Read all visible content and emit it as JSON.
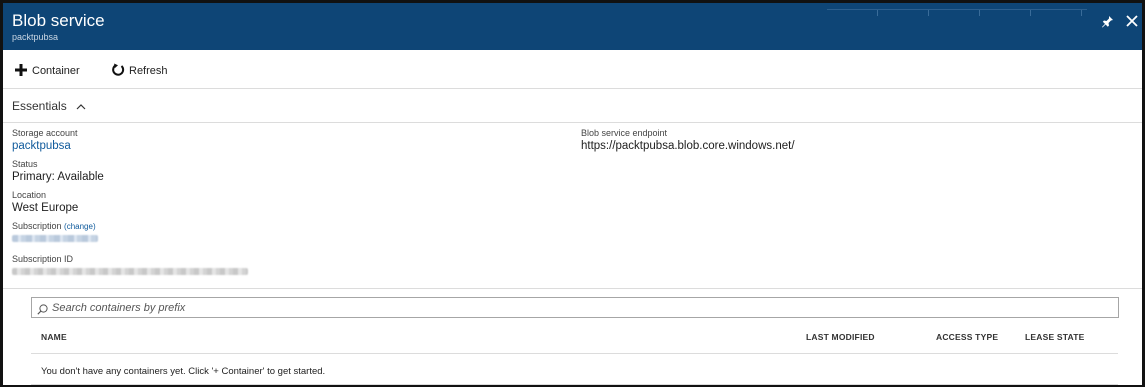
{
  "header": {
    "title": "Blob service",
    "subtitle": "packtpubsa"
  },
  "toolbar": {
    "container_label": "Container",
    "refresh_label": "Refresh"
  },
  "essentials": {
    "label": "Essentials",
    "storage_account_label": "Storage account",
    "storage_account_value": "packtpubsa",
    "status_label": "Status",
    "status_value": "Primary: Available",
    "location_label": "Location",
    "location_value": "West Europe",
    "subscription_label": "Subscription",
    "subscription_change": "(change)",
    "subscription_id_label": "Subscription ID",
    "endpoint_label": "Blob service endpoint",
    "endpoint_value": "https://packtpubsa.blob.core.windows.net/"
  },
  "search": {
    "placeholder": "Search containers by prefix"
  },
  "table": {
    "columns": [
      "NAME",
      "LAST MODIFIED",
      "ACCESS TYPE",
      "LEASE STATE"
    ],
    "empty_message": "You don't have any containers yet. Click '+ Container' to get started."
  },
  "colors": {
    "header_bg": "#0e4576",
    "link": "#0f5a9c"
  },
  "icons": [
    "plus-icon",
    "refresh-icon",
    "chevron-up-icon",
    "pin-icon",
    "close-icon",
    "search-icon"
  ]
}
